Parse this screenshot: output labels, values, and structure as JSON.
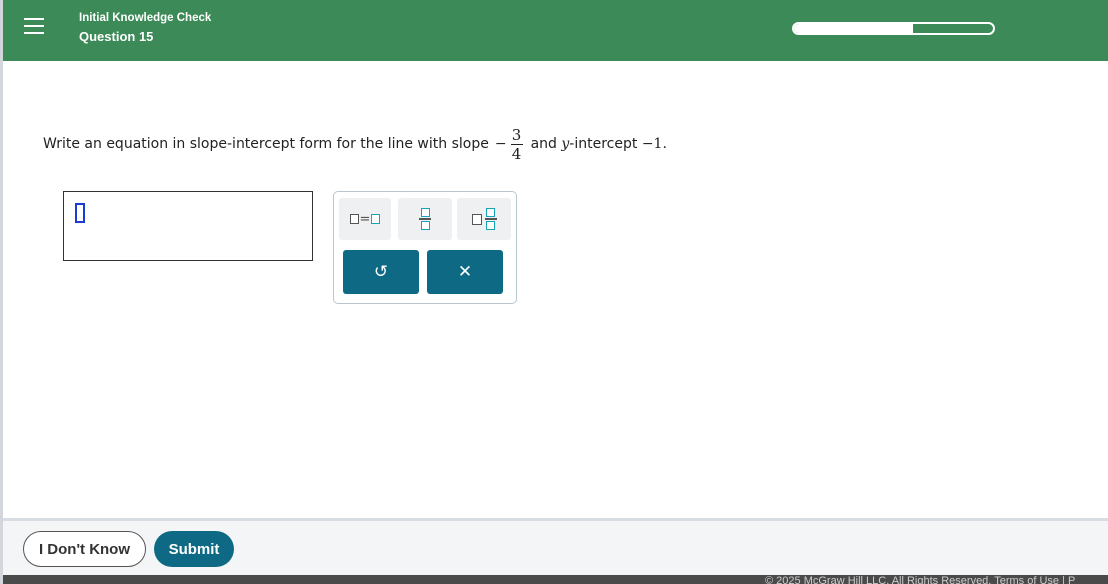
{
  "header": {
    "menu_icon": "hamburger-menu-icon",
    "title": "Initial Knowledge Check",
    "subtitle": "Question 15",
    "progress_fraction": 0.6,
    "background_color": "#3b8a57"
  },
  "question": {
    "prefix": "Write an equation in slope-intercept form for the line with slope",
    "slope_sign": "−",
    "slope_numerator": "3",
    "slope_denominator": "4",
    "middle": "and",
    "y_var": "y",
    "suffix_label": "-intercept",
    "intercept_value": "−1."
  },
  "answer": {
    "value": ""
  },
  "palette": {
    "buttons": [
      {
        "name": "equals-template",
        "icon": "box-equals-box-icon"
      },
      {
        "name": "fraction-template",
        "icon": "fraction-icon"
      },
      {
        "name": "mixed-number-template",
        "icon": "mixed-number-icon"
      }
    ],
    "undo_icon": "undo-icon",
    "clear_icon": "close-icon",
    "undo_symbol": "↺",
    "clear_symbol": "✕",
    "accent_color": "#0e6a84"
  },
  "footer": {
    "dont_know_label": "I Don't Know",
    "submit_label": "Submit",
    "copyright": "© 2025 McGraw Hill LLC. All Rights Reserved.    Terms of Use   |   P"
  }
}
